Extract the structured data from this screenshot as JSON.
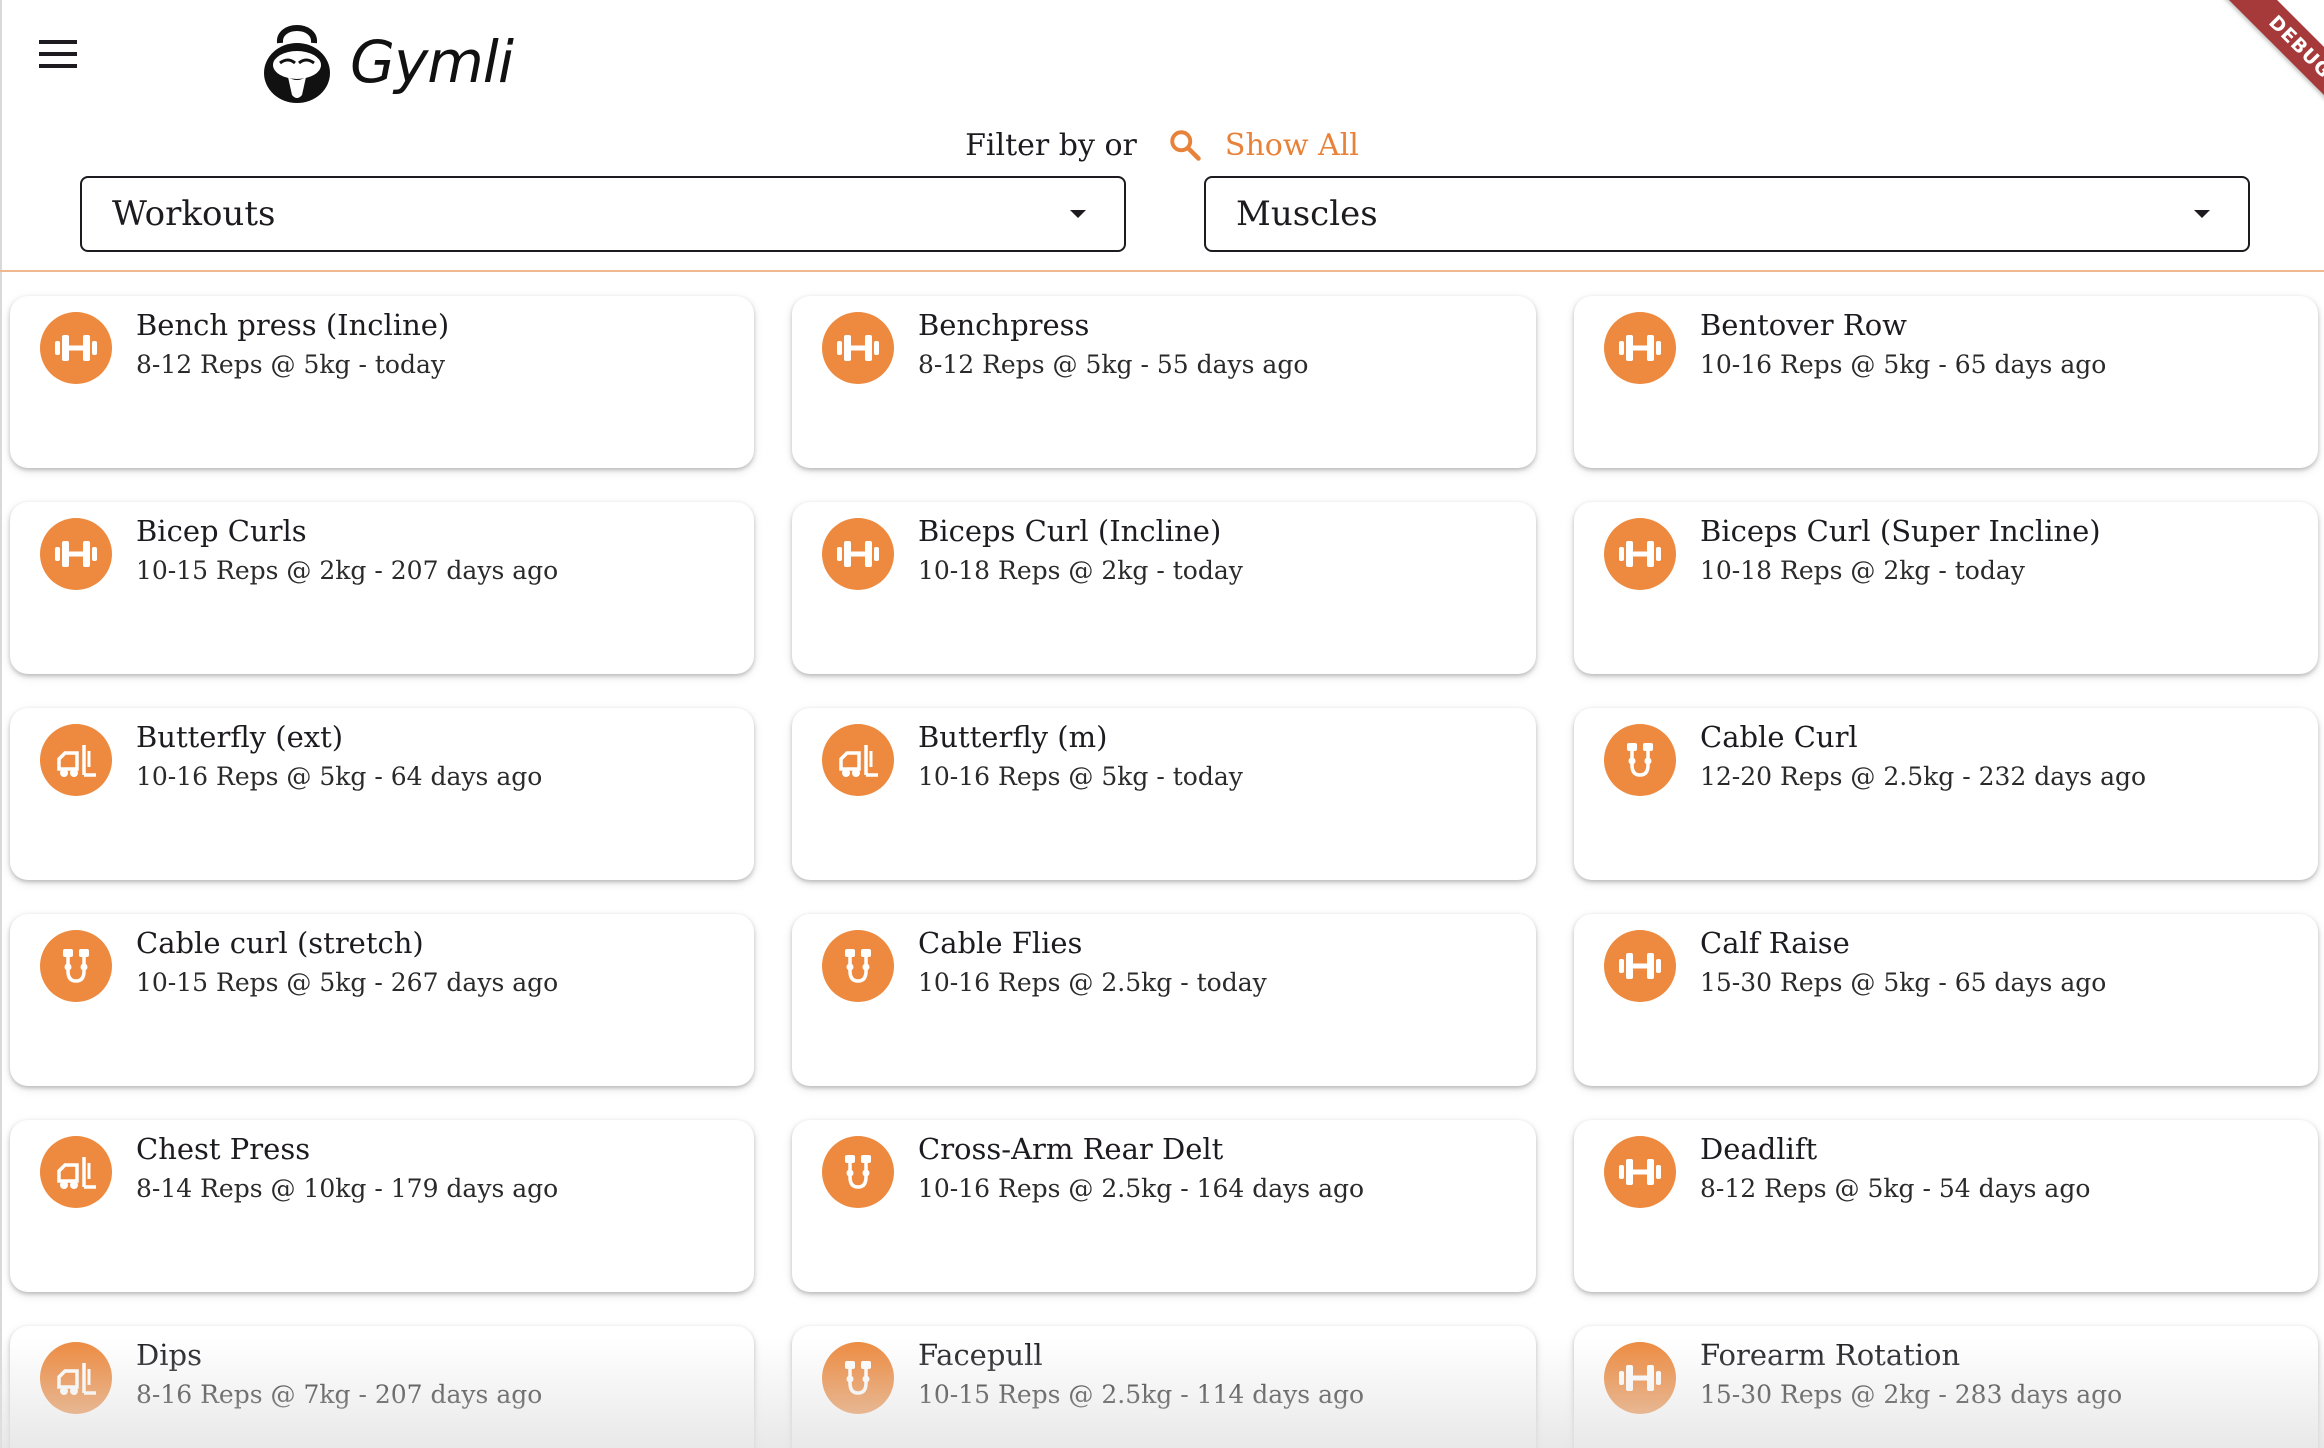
{
  "app": {
    "title": "Gymli",
    "debug_label": "DEBUG",
    "accent_color": "#ed8a3f",
    "menu_icon": "menu-icon"
  },
  "filter": {
    "label": "Filter by or",
    "show_all_label": "Show All",
    "show_all_icon": "search-icon",
    "workouts_dropdown": {
      "value": "Workouts"
    },
    "muscles_dropdown": {
      "value": "Muscles"
    }
  },
  "exercises": [
    {
      "name": "Bench press (Incline)",
      "detail": "8-12 Reps @ 5kg - today",
      "icon": "dumbbell-icon"
    },
    {
      "name": "Benchpress",
      "detail": "8-12 Reps @ 5kg - 55 days ago",
      "icon": "dumbbell-icon"
    },
    {
      "name": "Bentover Row",
      "detail": "10-16 Reps @ 5kg - 65 days ago",
      "icon": "dumbbell-icon"
    },
    {
      "name": "Bicep Curls",
      "detail": "10-15 Reps @ 2kg - 207 days ago",
      "icon": "dumbbell-icon"
    },
    {
      "name": "Biceps Curl (Incline)",
      "detail": "10-18 Reps @ 2kg - today",
      "icon": "dumbbell-icon"
    },
    {
      "name": "Biceps Curl (Super Incline)",
      "detail": "10-18 Reps @ 2kg - today",
      "icon": "dumbbell-icon"
    },
    {
      "name": "Butterfly (ext)",
      "detail": "10-16 Reps @ 5kg - 64 days ago",
      "icon": "machine-icon"
    },
    {
      "name": "Butterfly (m)",
      "detail": "10-16 Reps @ 5kg - today",
      "icon": "machine-icon"
    },
    {
      "name": "Cable Curl",
      "detail": "12-20 Reps @ 2.5kg - 232 days ago",
      "icon": "cable-icon"
    },
    {
      "name": "Cable curl (stretch)",
      "detail": "10-15 Reps @ 5kg - 267 days ago",
      "icon": "cable-icon"
    },
    {
      "name": "Cable Flies",
      "detail": "10-16 Reps @ 2.5kg - today",
      "icon": "cable-icon"
    },
    {
      "name": "Calf Raise",
      "detail": "15-30 Reps @ 5kg - 65 days ago",
      "icon": "dumbbell-icon"
    },
    {
      "name": "Chest Press",
      "detail": "8-14 Reps @ 10kg - 179 days ago",
      "icon": "machine-icon"
    },
    {
      "name": "Cross-Arm Rear Delt",
      "detail": "10-16 Reps @ 2.5kg - 164 days ago",
      "icon": "cable-icon"
    },
    {
      "name": "Deadlift",
      "detail": "8-12 Reps @ 5kg - 54 days ago",
      "icon": "dumbbell-icon"
    },
    {
      "name": "Dips",
      "detail": "8-16 Reps @ 7kg - 207 days ago",
      "icon": "machine-icon"
    },
    {
      "name": "Facepull",
      "detail": "10-15 Reps @ 2.5kg - 114 days ago",
      "icon": "cable-icon"
    },
    {
      "name": "Forearm Rotation",
      "detail": "15-30 Reps @ 2kg - 283 days ago",
      "icon": "dumbbell-icon"
    }
  ]
}
